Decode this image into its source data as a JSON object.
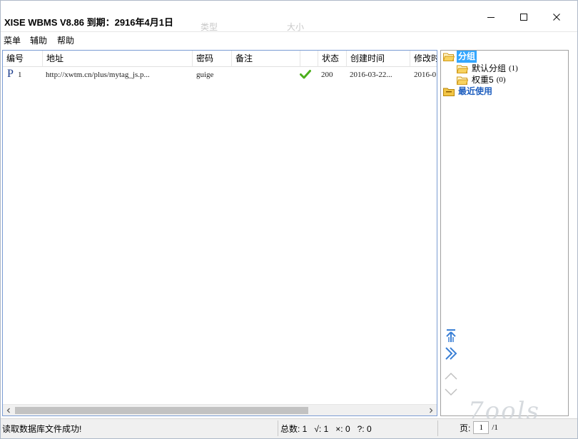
{
  "window": {
    "title": "XISE WBMS V8.86 到期：2916年4月1日",
    "ghost_labels": [
      "类型",
      "大小"
    ]
  },
  "menu": [
    "菜单",
    "辅助",
    "帮助"
  ],
  "grid": {
    "columns": [
      "编号",
      "地址",
      "密码",
      "备注",
      "",
      "状态",
      "创建时间",
      "修改时"
    ],
    "rows": [
      {
        "id": "1",
        "address": "http://xwtm.cn/plus/mytag_js.p...",
        "password": "guige",
        "note": "",
        "status_icon": "check-icon",
        "status": "200",
        "created": "2016-03-22...",
        "modified": "2016-0"
      }
    ]
  },
  "tree": {
    "root": "分组",
    "children": [
      {
        "label": "默认分组",
        "count": "(1)"
      },
      {
        "label": "权重5",
        "count": "(0)"
      }
    ],
    "recent": "最近使用"
  },
  "status": {
    "message": "读取数据库文件成功!",
    "stats": "总数: 1   √: 1   ×: 0   ?: 0",
    "page_label": "页:",
    "page_current": "1",
    "page_total": "/1"
  },
  "colors": {
    "selection": "#33a6ff",
    "folder": "#f2c545",
    "check": "#4caf1c",
    "grid_border": "#7a9cd3"
  },
  "watermark": "7ools"
}
